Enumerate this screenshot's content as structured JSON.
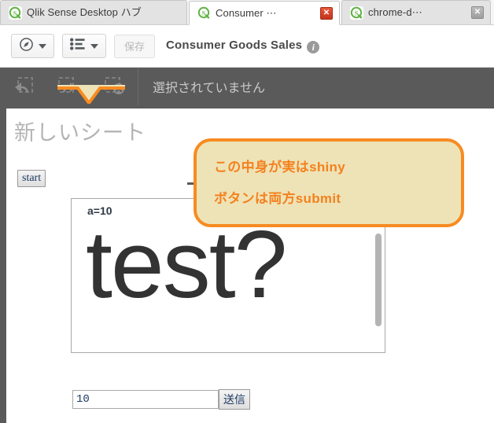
{
  "browser": {
    "tabs": [
      {
        "label": "Qlik Sense Desktop ハブ",
        "icon": "qlik-logo-icon",
        "active": false,
        "close": null
      },
      {
        "label": "Consumer ⋯",
        "icon": "qlik-logo-icon",
        "active": true,
        "close": "red"
      },
      {
        "label": "chrome-d⋯",
        "icon": "qlik-logo-icon",
        "active": false,
        "close": "grey"
      }
    ]
  },
  "toolbar": {
    "nav_button_icon": "compass-icon",
    "sheets_button_icon": "list-icon",
    "save_label": "保存",
    "app_title": "Consumer Goods Sales",
    "info_glyph": "i"
  },
  "selection_bar": {
    "step_back_icon": "selection-step-back-icon",
    "step_forward_icon": "selection-step-forward-icon",
    "clear_all_icon": "selection-clear-all-icon",
    "status_text": "選択されていません"
  },
  "sheet": {
    "title": "新しいシート",
    "start_button_label": "start"
  },
  "shiny_frame": {
    "variable_text": "a=10",
    "heading_text": "test?",
    "scrollbar": "vertical-scrollbar"
  },
  "form": {
    "input_value": "10",
    "input_placeholder": "",
    "submit_label": "送信"
  },
  "callout": {
    "line1": "この中身が実はshiny",
    "line2": "ボタンは両方submit",
    "border_color": "#f78b21",
    "fill_color": "#eee3b6",
    "text_color": "#f4811f"
  },
  "colors": {
    "selection_bar_bg": "#5a5a5a",
    "tab_active_bg": "#ffffff",
    "tab_inactive_bg": "#e3e3e3",
    "qlik_green": "#61b346"
  }
}
